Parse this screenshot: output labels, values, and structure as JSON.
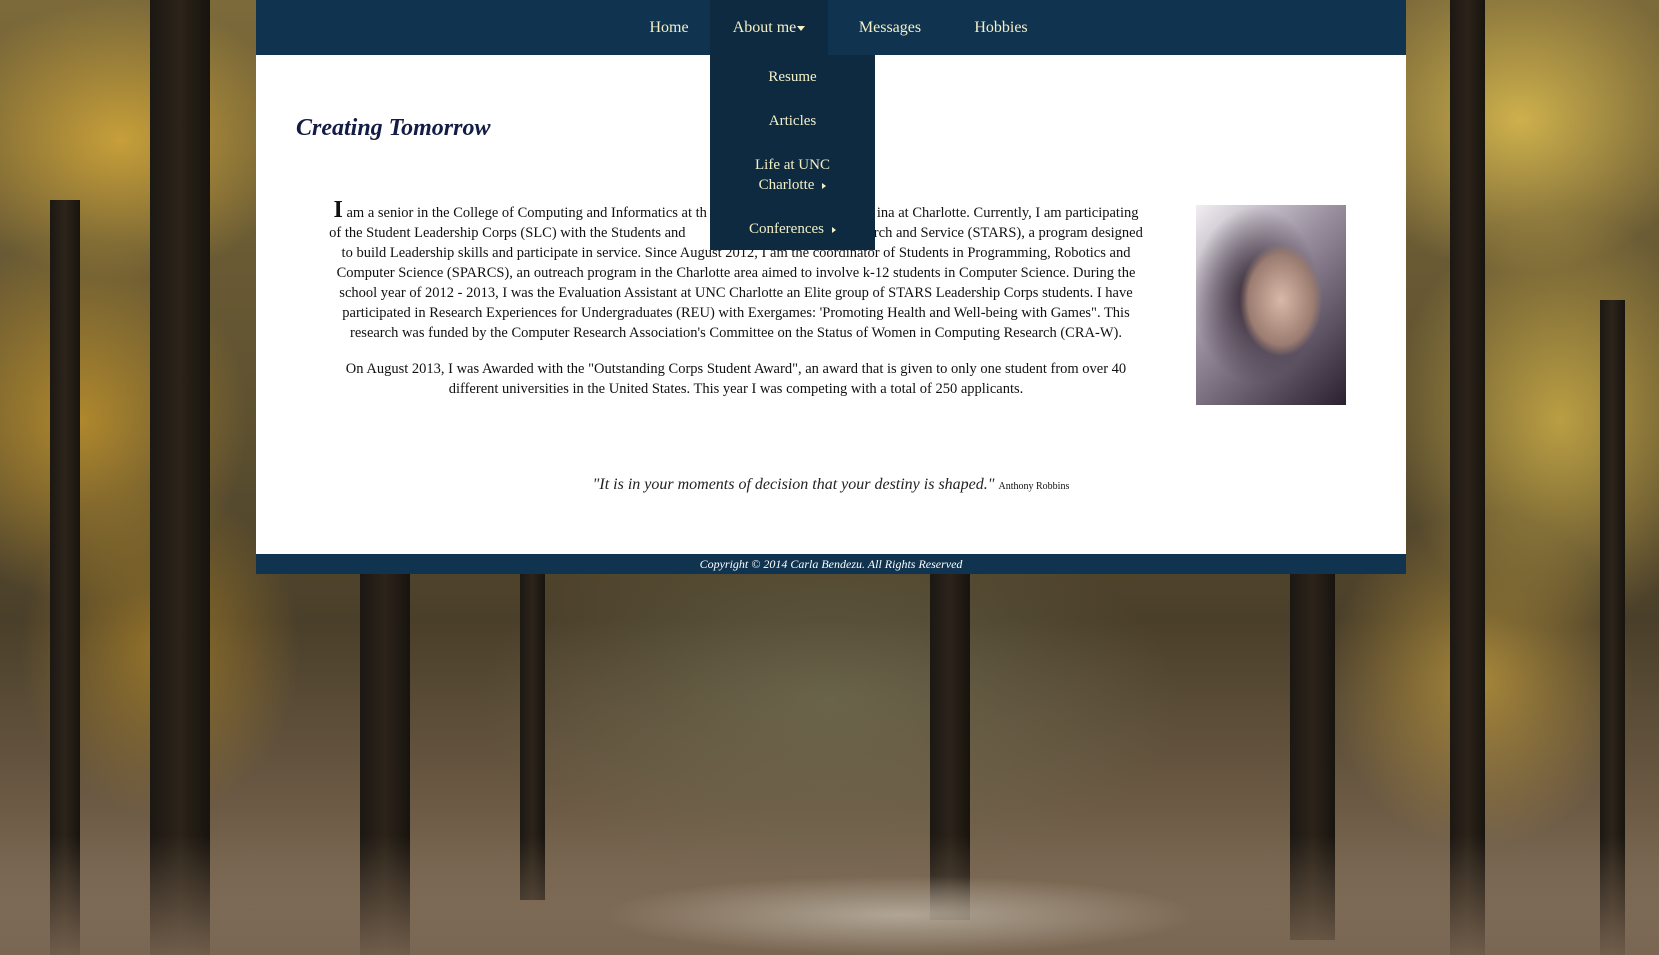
{
  "nav": {
    "items": [
      {
        "label": "Home"
      },
      {
        "label": "About me"
      },
      {
        "label": "Messages"
      },
      {
        "label": "Hobbies"
      }
    ],
    "dropdown": [
      {
        "label": "Resume"
      },
      {
        "label": "Articles"
      },
      {
        "label_line1": "Life at UNC",
        "label_line2": "Charlotte"
      },
      {
        "label": "Conferences"
      }
    ]
  },
  "page": {
    "title": "Creating Tomorrow",
    "paragraph1_dropcap": "I",
    "paragraph1_visible_before": " am a senior in the College of Computing and Informatics at th",
    "paragraph1_visible_after": "ina at Charlotte. Currently, I am participating of the Student Leadership Corps (SLC) with the Students and",
    "paragraph1_visible_after2": " Research and Service (STARS), a program designed to build Leadership skills and participate in service. Since August 2012, I am the coordinator of Students in Programming, Robotics and Computer Science (SPARCS), an outreach program in the Charlotte area aimed to involve k-12 students in Computer Science. During the school year of 2012 - 2013, I was the Evaluation Assistant at UNC Charlotte an Elite group of STARS Leadership Corps students. I have participated in Research Experiences for Undergraduates (REU) with Exergames: 'Promoting Health and Well-being with Games\". This research was funded by the Computer Research Association's Committee on the Status of Women in Computing Research (CRA-W).",
    "paragraph2": "On August 2013, I was Awarded with the \"Outstanding Corps Student Award\", an award that is given to only one student from over 40 different universities in the United States. This year I was competing with a total of 250 applicants.",
    "quote_text": "\"It is in your moments of decision that your destiny is shaped.\"",
    "quote_author": "Anthony Robbins"
  },
  "footer": {
    "copyright": "Copyright © 2014 Carla Bendezu. All Rights Reserved"
  },
  "colors": {
    "navbar": "#10334f",
    "nav_text": "#f3f0c7",
    "dropdown_bg": "#0d2a41",
    "title": "#121c44"
  }
}
